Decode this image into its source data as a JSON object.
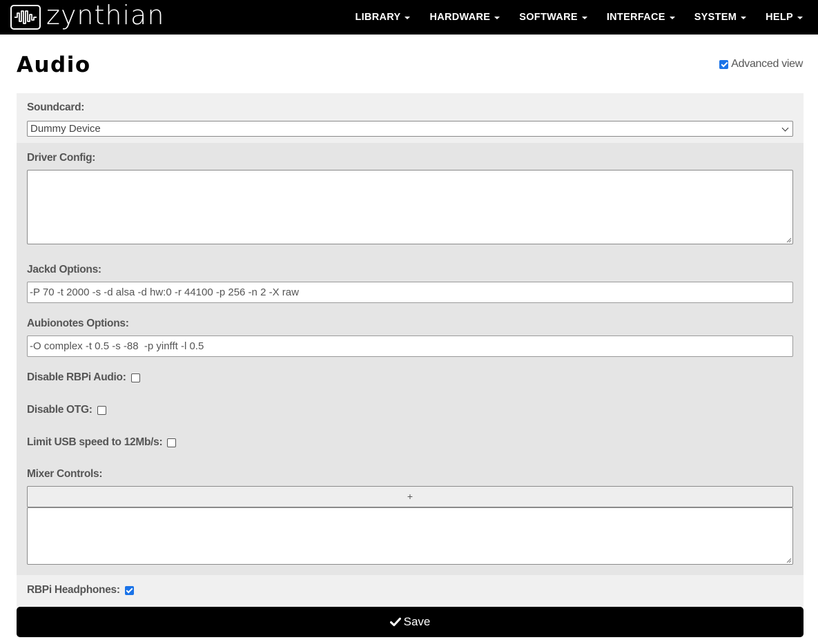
{
  "brand": {
    "name": "zynthian"
  },
  "nav": {
    "items": [
      {
        "label": "LIBRARY"
      },
      {
        "label": "HARDWARE"
      },
      {
        "label": "SOFTWARE"
      },
      {
        "label": "INTERFACE"
      },
      {
        "label": "SYSTEM"
      },
      {
        "label": "HELP"
      }
    ]
  },
  "page": {
    "title": "Audio",
    "advanced_view": {
      "label": "Advanced view",
      "checked": true
    }
  },
  "form": {
    "soundcard": {
      "label": "Soundcard:",
      "value": "Dummy Device"
    },
    "driver_config": {
      "label": "Driver Config:",
      "value": ""
    },
    "jackd_options": {
      "label": "Jackd Options:",
      "value": "-P 70 -t 2000 -s -d alsa -d hw:0 -r 44100 -p 256 -n 2 -X raw"
    },
    "aubionotes_options": {
      "label": "Aubionotes Options:",
      "value": "-O complex -t 0.5 -s -88  -p yinfft -l 0.5"
    },
    "disable_rbpi_audio": {
      "label": "Disable RBPi Audio:",
      "checked": false
    },
    "disable_otg": {
      "label": "Disable OTG:",
      "checked": false
    },
    "limit_usb_speed": {
      "label": "Limit USB speed to 12Mb/s:",
      "checked": false
    },
    "mixer_controls": {
      "label": "Mixer Controls:",
      "add_label": "+",
      "value": ""
    },
    "rbpi_headphones": {
      "label": "RBPi Headphones:",
      "checked": true
    }
  },
  "actions": {
    "save_label": "Save"
  },
  "colors": {
    "navbar_bg": "#000000",
    "panel_light": "#f0f0f0",
    "panel_dark": "#e5e5e5",
    "checkbox_accent": "#1a73e8"
  },
  "icons": {
    "brand": "waveform-logo-icon",
    "save": "check-icon",
    "dropdown": "chevron-down-icon"
  }
}
